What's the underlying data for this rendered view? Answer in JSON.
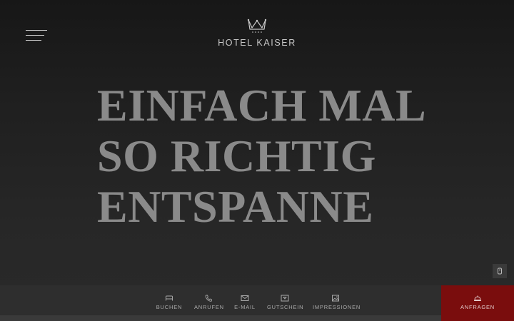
{
  "header": {
    "logo_text": "HOTEL KAISER"
  },
  "hero": {
    "lines": [
      "EINFACH MAL",
      "SO RICHTIG",
      "ENTSPANNE"
    ]
  },
  "bottom_bar": {
    "items": [
      {
        "label": "BUCHEN",
        "icon": "bed-icon"
      },
      {
        "label": "ANRUFEN",
        "icon": "phone-icon"
      },
      {
        "label": "E-MAIL",
        "icon": "envelope-icon"
      },
      {
        "label": "GUTSCHEIN",
        "icon": "gift-card-icon"
      },
      {
        "label": "IMPRESSIONEN",
        "icon": "image-icon"
      }
    ],
    "cta": {
      "label": "ANFRAGEN",
      "icon": "service-bell-icon"
    }
  },
  "colors": {
    "background": "#1f1f1f",
    "hero_text": "#8a8a8a",
    "cta_background": "#7a0d0d",
    "bar_background": "#2e2e2e"
  }
}
